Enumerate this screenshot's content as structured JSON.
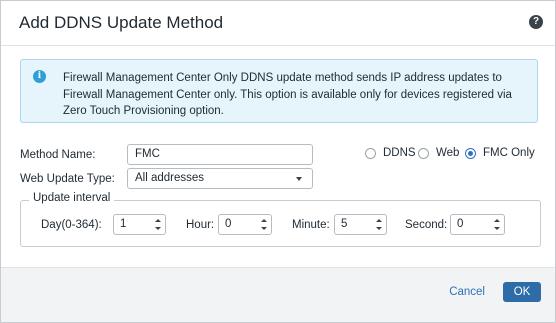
{
  "dialog": {
    "title": "Add DDNS Update Method",
    "help_icon": "question-mark-icon"
  },
  "info": {
    "icon": "info-icon",
    "text": "Firewall Management Center Only DDNS update method sends IP address updates to Firewall Management Center only. This option is available only for devices registered via Zero Touch Provisioning option."
  },
  "form": {
    "method_name_label": "Method Name:",
    "method_name_value": "FMC",
    "web_update_type_label": "Web Update Type:",
    "web_update_type_value": "All addresses",
    "radios": [
      {
        "label": "DDNS",
        "checked": false
      },
      {
        "label": "Web",
        "checked": false
      },
      {
        "label": "FMC Only",
        "checked": true
      }
    ]
  },
  "update_interval": {
    "legend": "Update interval",
    "day_label": "Day(0-364):",
    "day_value": "1",
    "hour_label": "Hour:",
    "hour_value": "0",
    "minute_label": "Minute:",
    "minute_value": "5",
    "second_label": "Second:",
    "second_value": "0"
  },
  "footer": {
    "cancel_label": "Cancel",
    "ok_label": "OK"
  },
  "colors": {
    "accent": "#2d6ca8",
    "info_bg": "#e6f4fb",
    "info_border": "#a9d8ef"
  }
}
